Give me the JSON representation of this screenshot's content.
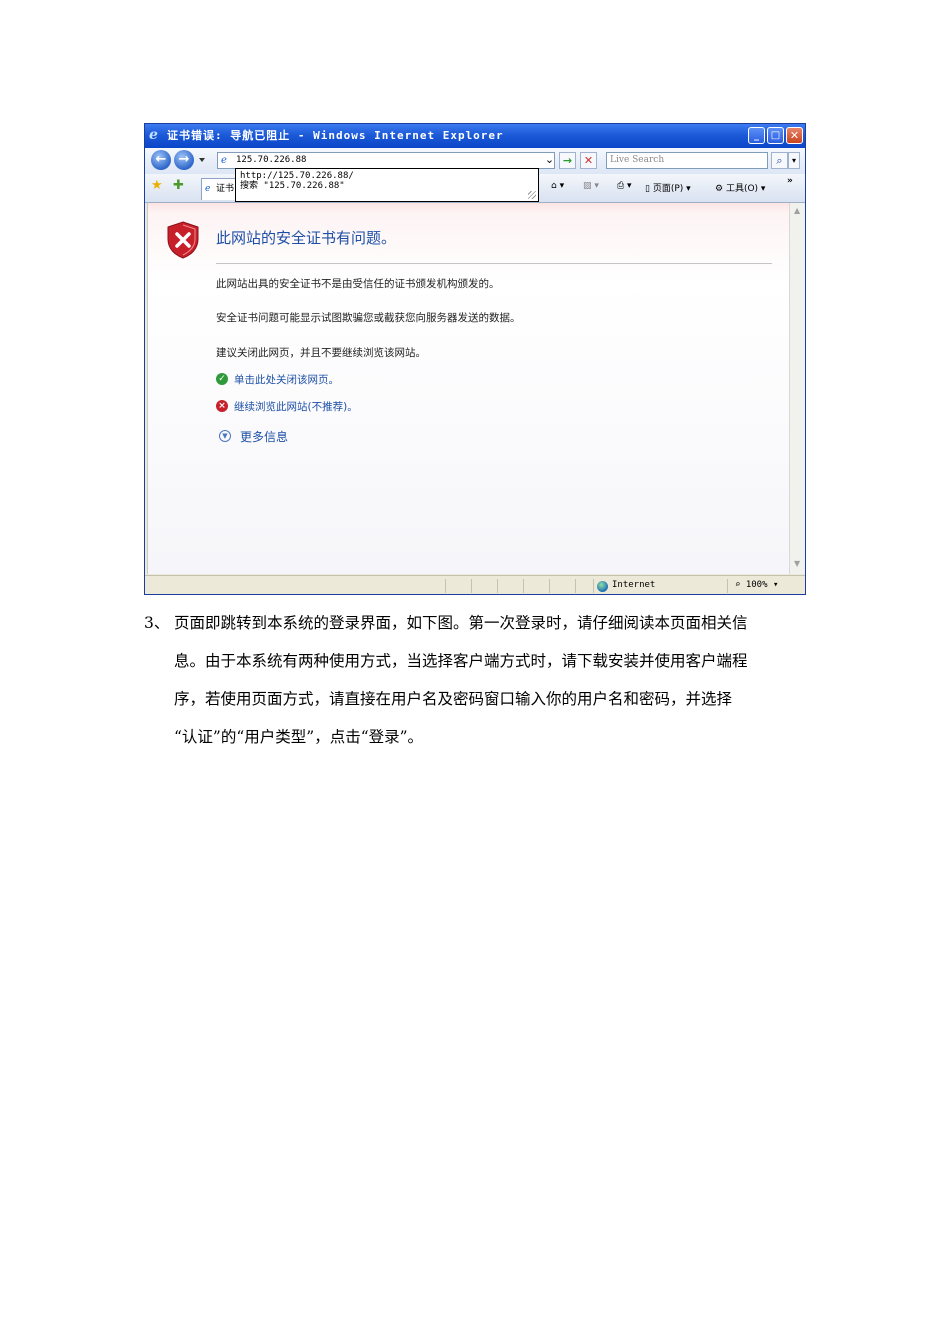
{
  "window": {
    "title": "证书错误: 导航已阻止 - Windows Internet Explorer",
    "minimize_glyph": "_",
    "maximize_glyph": "□",
    "close_glyph": "✕"
  },
  "navigation": {
    "address": "125.70.226.88",
    "search_placeholder": "Live Search",
    "dropdown": {
      "suggestion_url": "http://125.70.226.88/",
      "suggestion_search": "搜索 \"125.70.226.88\""
    },
    "tab_label": "证书"
  },
  "command_bar": {
    "page_label": "页面(P)",
    "tools_label": "工具(O)",
    "chevron": "»"
  },
  "error_page": {
    "title": "此网站的安全证书有问题。",
    "line1": "此网站出具的安全证书不是由受信任的证书颁发机构颁发的。",
    "line2": "安全证书问题可能显示试图欺骗您或截获您向服务器发送的数据。",
    "line3": "建议关闭此网页，并且不要继续浏览该网站。",
    "close_link": "单击此处关闭该网页。",
    "continue_link": "继续浏览此网站(不推荐)。",
    "more_info": "更多信息"
  },
  "status_bar": {
    "zone": "Internet",
    "zoom": "100%"
  },
  "instructions": {
    "number": "3、",
    "lines": [
      "页面即跳转到本系统的登录界面，如下图。第一次登录时，请仔细阅读本页面相关信",
      "息。由于本系统有两种使用方式，当选择客户端方式时，请下载安装并使用客户端程",
      "序，若使用页面方式，请直接在用户名及密码窗口输入你的用户名和密码，并选择",
      "“认证”的“用户类型”，点击“登录”。"
    ]
  },
  "colors": {
    "title_bar": "#0a46c8",
    "link_blue": "#1d4fa6",
    "error_red": "#c8202a",
    "ok_green": "#2e9a3a"
  }
}
